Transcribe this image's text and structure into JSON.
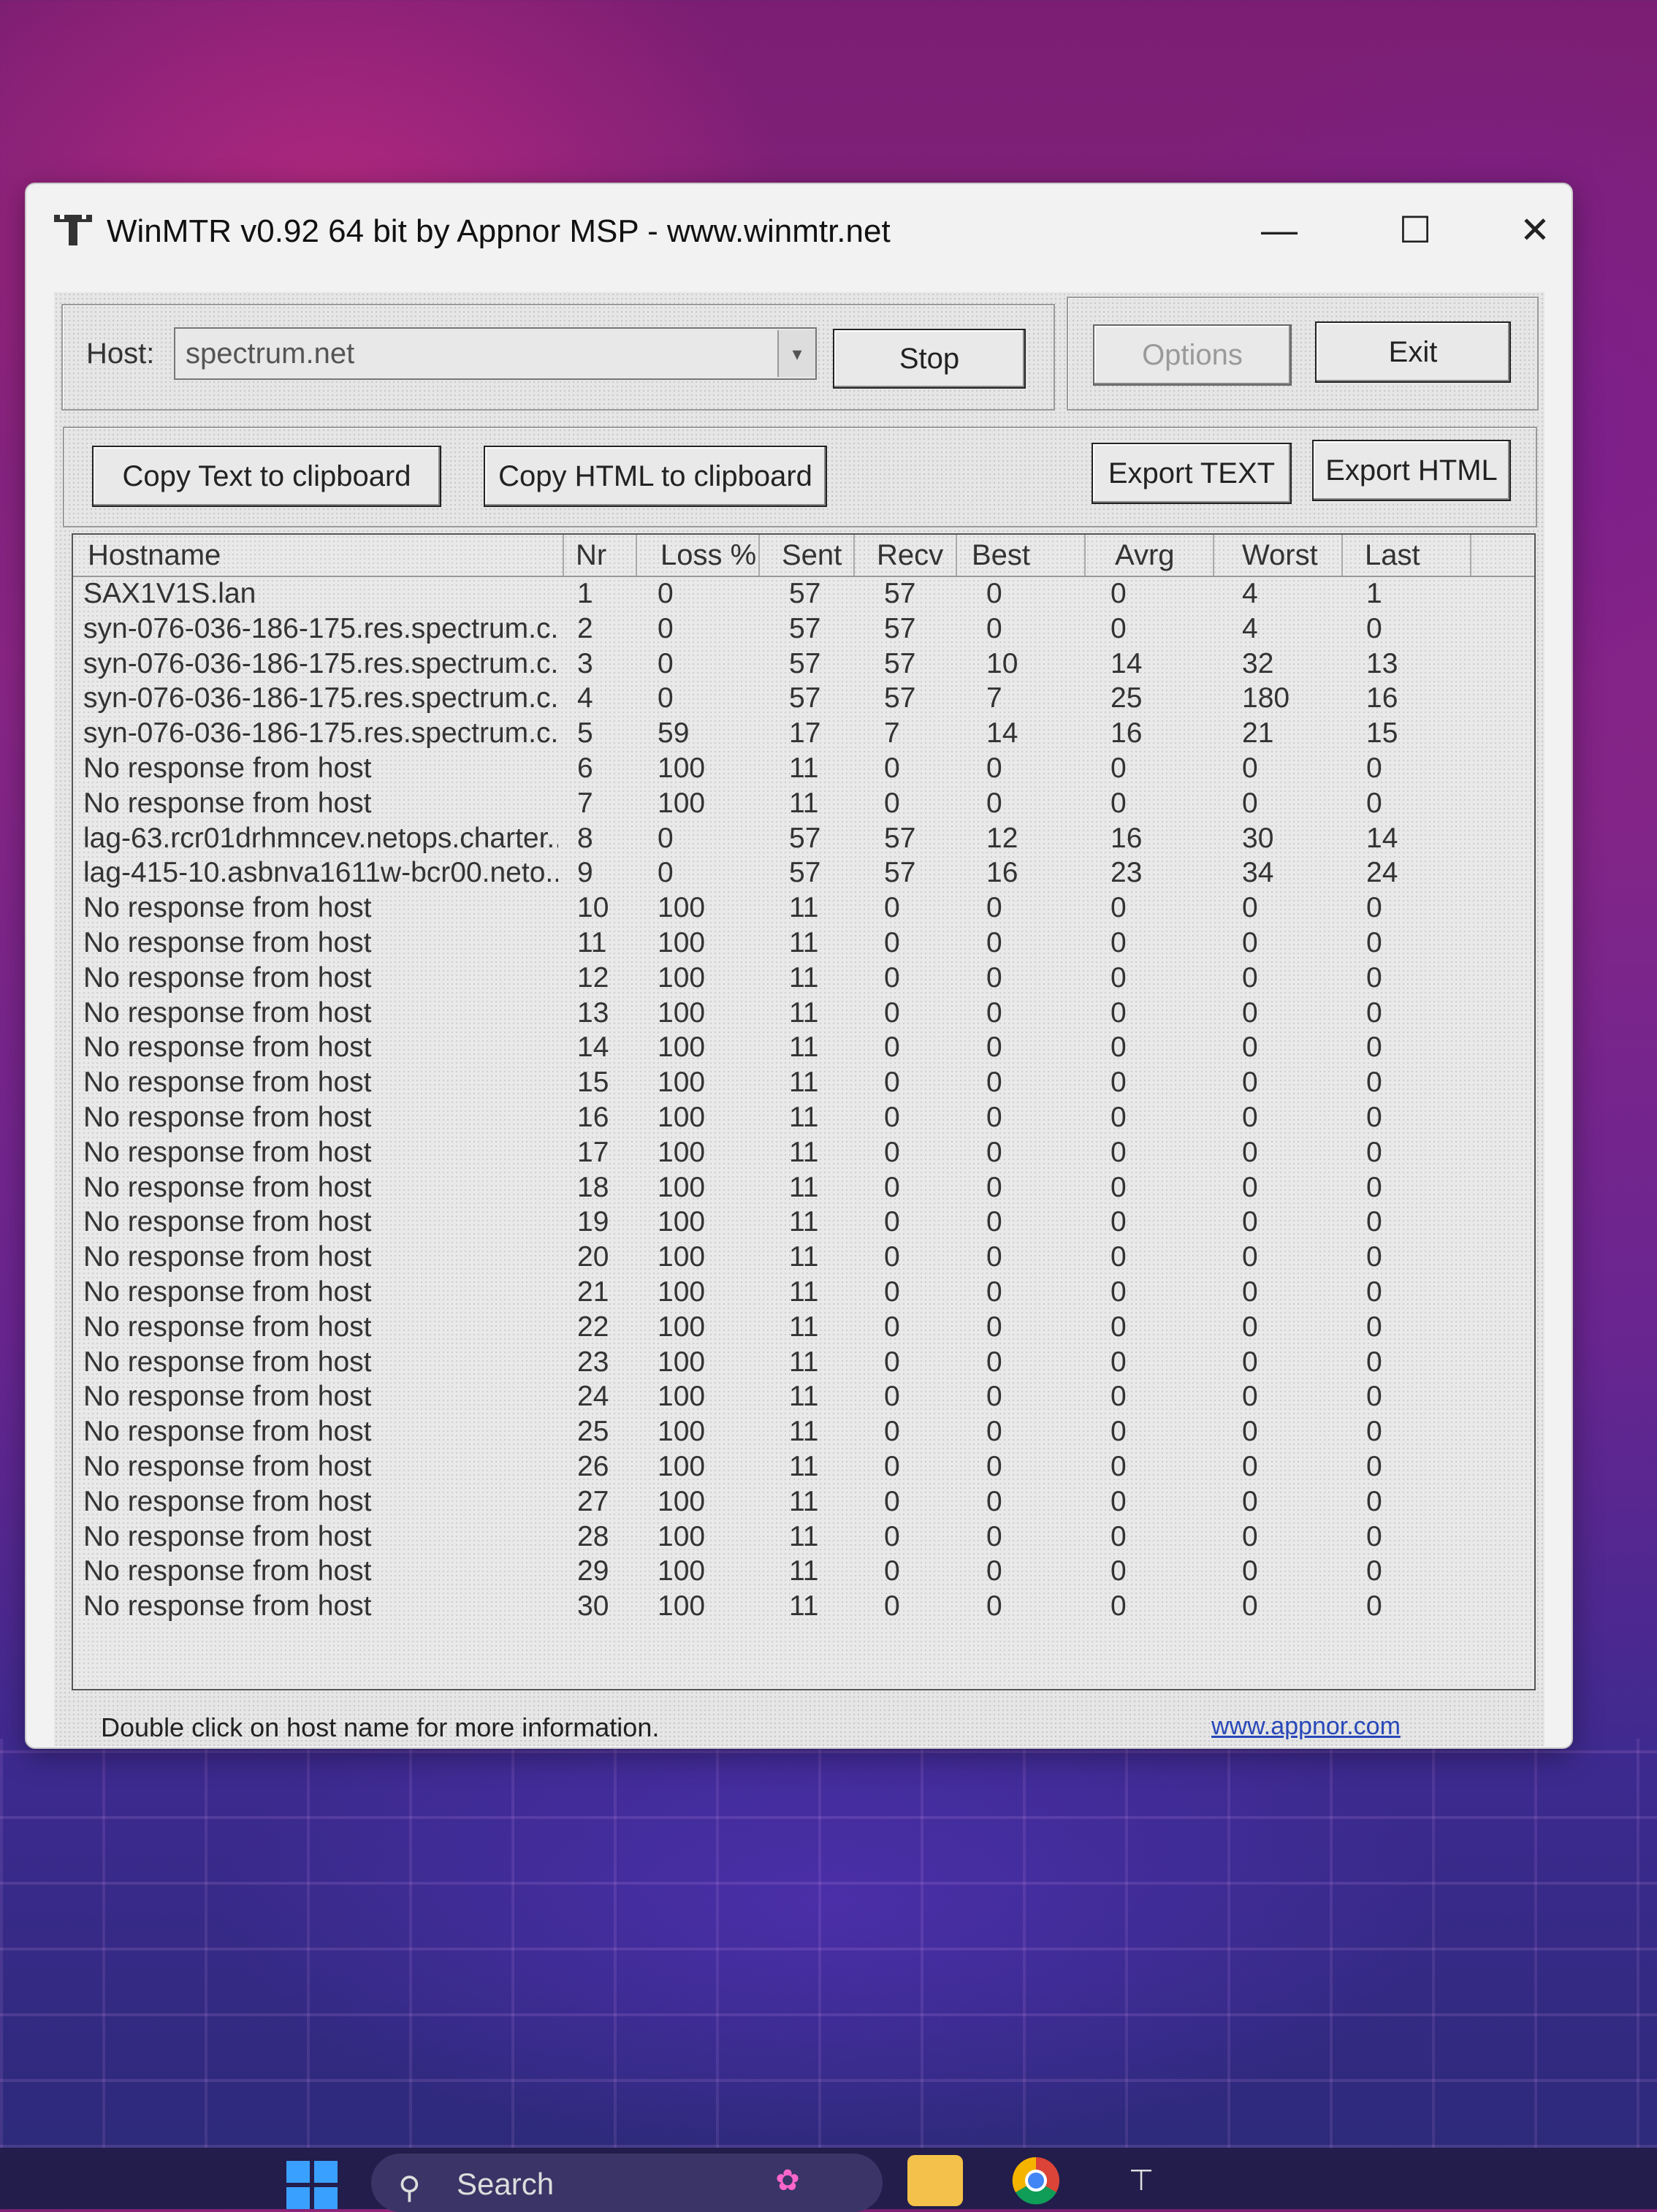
{
  "window": {
    "title": "WinMTR v0.92 64 bit by Appnor MSP - www.winmtr.net",
    "min_glyph": "—",
    "max_glyph": "☐",
    "close_glyph": "✕"
  },
  "host": {
    "label": "Host:",
    "value": "spectrum.net",
    "dropdown_glyph": "▾"
  },
  "buttons": {
    "stop": "Stop",
    "options": "Options",
    "exit": "Exit",
    "copy_text": "Copy Text to clipboard",
    "copy_html": "Copy HTML to clipboard",
    "export_text": "Export TEXT",
    "export_html": "Export HTML"
  },
  "table": {
    "columns": [
      "Hostname",
      "Nr",
      "Loss %",
      "Sent",
      "Recv",
      "Best",
      "Avrg",
      "Worst",
      "Last"
    ],
    "rows": [
      [
        "SAX1V1S.lan",
        "1",
        "0",
        "57",
        "57",
        "0",
        "0",
        "4",
        "1"
      ],
      [
        "syn-076-036-186-175.res.spectrum.c...",
        "2",
        "0",
        "57",
        "57",
        "0",
        "0",
        "4",
        "0"
      ],
      [
        "syn-076-036-186-175.res.spectrum.c...",
        "3",
        "0",
        "57",
        "57",
        "10",
        "14",
        "32",
        "13"
      ],
      [
        "syn-076-036-186-175.res.spectrum.c...",
        "4",
        "0",
        "57",
        "57",
        "7",
        "25",
        "180",
        "16"
      ],
      [
        "syn-076-036-186-175.res.spectrum.c...",
        "5",
        "59",
        "17",
        "7",
        "14",
        "16",
        "21",
        "15"
      ],
      [
        "No response from host",
        "6",
        "100",
        "11",
        "0",
        "0",
        "0",
        "0",
        "0"
      ],
      [
        "No response from host",
        "7",
        "100",
        "11",
        "0",
        "0",
        "0",
        "0",
        "0"
      ],
      [
        "lag-63.rcr01drhmncev.netops.charter...",
        "8",
        "0",
        "57",
        "57",
        "12",
        "16",
        "30",
        "14"
      ],
      [
        "lag-415-10.asbnva1611w-bcr00.neto...",
        "9",
        "0",
        "57",
        "57",
        "16",
        "23",
        "34",
        "24"
      ],
      [
        "No response from host",
        "10",
        "100",
        "11",
        "0",
        "0",
        "0",
        "0",
        "0"
      ],
      [
        "No response from host",
        "11",
        "100",
        "11",
        "0",
        "0",
        "0",
        "0",
        "0"
      ],
      [
        "No response from host",
        "12",
        "100",
        "11",
        "0",
        "0",
        "0",
        "0",
        "0"
      ],
      [
        "No response from host",
        "13",
        "100",
        "11",
        "0",
        "0",
        "0",
        "0",
        "0"
      ],
      [
        "No response from host",
        "14",
        "100",
        "11",
        "0",
        "0",
        "0",
        "0",
        "0"
      ],
      [
        "No response from host",
        "15",
        "100",
        "11",
        "0",
        "0",
        "0",
        "0",
        "0"
      ],
      [
        "No response from host",
        "16",
        "100",
        "11",
        "0",
        "0",
        "0",
        "0",
        "0"
      ],
      [
        "No response from host",
        "17",
        "100",
        "11",
        "0",
        "0",
        "0",
        "0",
        "0"
      ],
      [
        "No response from host",
        "18",
        "100",
        "11",
        "0",
        "0",
        "0",
        "0",
        "0"
      ],
      [
        "No response from host",
        "19",
        "100",
        "11",
        "0",
        "0",
        "0",
        "0",
        "0"
      ],
      [
        "No response from host",
        "20",
        "100",
        "11",
        "0",
        "0",
        "0",
        "0",
        "0"
      ],
      [
        "No response from host",
        "21",
        "100",
        "11",
        "0",
        "0",
        "0",
        "0",
        "0"
      ],
      [
        "No response from host",
        "22",
        "100",
        "11",
        "0",
        "0",
        "0",
        "0",
        "0"
      ],
      [
        "No response from host",
        "23",
        "100",
        "11",
        "0",
        "0",
        "0",
        "0",
        "0"
      ],
      [
        "No response from host",
        "24",
        "100",
        "11",
        "0",
        "0",
        "0",
        "0",
        "0"
      ],
      [
        "No response from host",
        "25",
        "100",
        "11",
        "0",
        "0",
        "0",
        "0",
        "0"
      ],
      [
        "No response from host",
        "26",
        "100",
        "11",
        "0",
        "0",
        "0",
        "0",
        "0"
      ],
      [
        "No response from host",
        "27",
        "100",
        "11",
        "0",
        "0",
        "0",
        "0",
        "0"
      ],
      [
        "No response from host",
        "28",
        "100",
        "11",
        "0",
        "0",
        "0",
        "0",
        "0"
      ],
      [
        "No response from host",
        "29",
        "100",
        "11",
        "0",
        "0",
        "0",
        "0",
        "0"
      ],
      [
        "No response from host",
        "30",
        "100",
        "11",
        "0",
        "0",
        "0",
        "0",
        "0"
      ]
    ]
  },
  "status": {
    "hint": "Double click on host name for more information.",
    "link": "www.appnor.com"
  },
  "taskbar": {
    "search_label": "Search",
    "icons": [
      "windows-start-icon",
      "search-icon",
      "widgets-icon",
      "file-explorer-icon",
      "chrome-icon",
      "winmtr-taskbar-icon"
    ]
  },
  "colors": {
    "window_bg": "#f2f2f2",
    "link": "#2848b8",
    "taskbar": "#221d4a"
  }
}
